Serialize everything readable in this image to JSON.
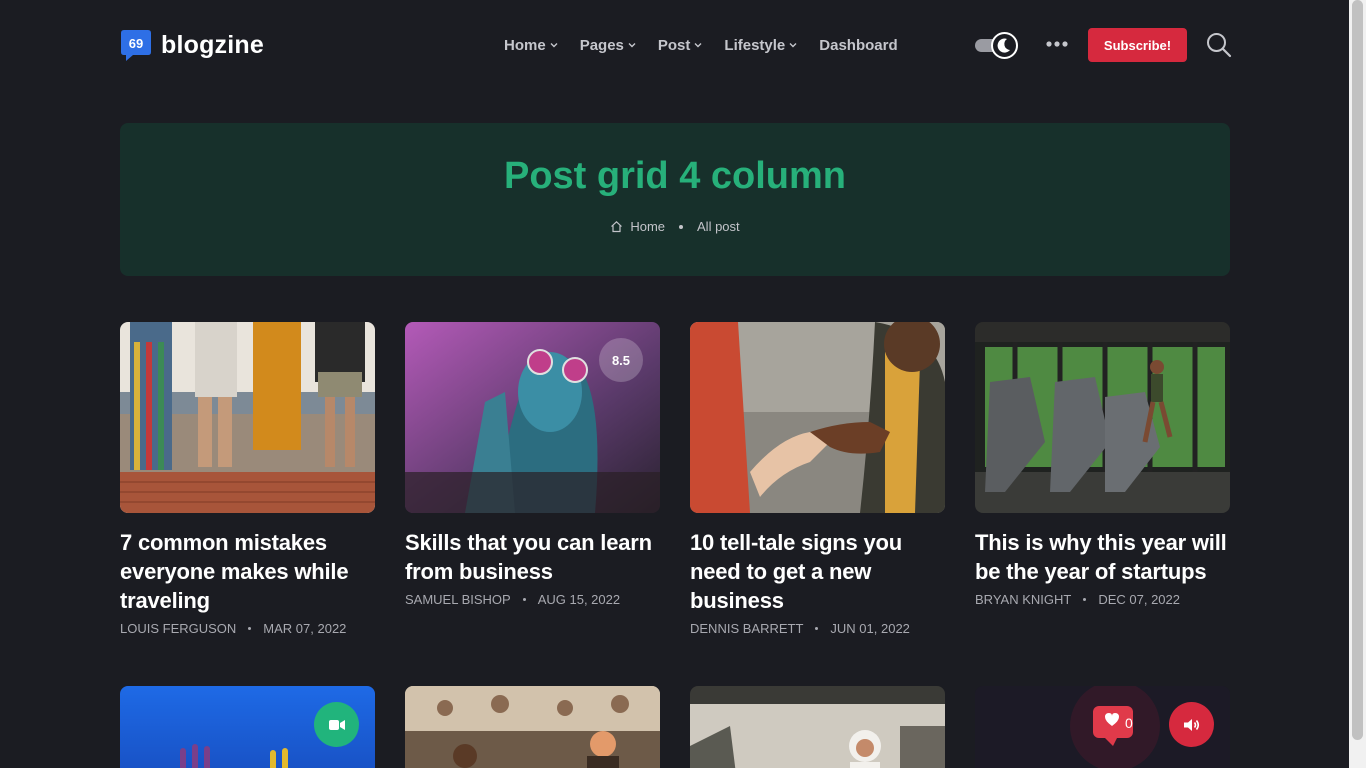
{
  "brand": {
    "name": "blogzine",
    "logo_glyph": "69"
  },
  "nav": {
    "items": [
      {
        "label": "Home",
        "has_dropdown": true
      },
      {
        "label": "Pages",
        "has_dropdown": true
      },
      {
        "label": "Post",
        "has_dropdown": true
      },
      {
        "label": "Lifestyle",
        "has_dropdown": true
      },
      {
        "label": "Dashboard",
        "has_dropdown": false
      }
    ],
    "theme_toggle": "dark",
    "more_icon": "ellipsis-icon",
    "subscribe_label": "Subscribe!",
    "search_icon": "search-icon"
  },
  "hero": {
    "title": "Post grid 4 column",
    "breadcrumb": [
      {
        "label": "Home",
        "icon": "home-icon"
      },
      {
        "label": "All post"
      }
    ]
  },
  "posts": [
    {
      "title": "7 common mistakes everyone makes while traveling",
      "author": "LOUIS FERGUSON",
      "date": "MAR 07, 2022"
    },
    {
      "title": "Skills that you can learn from business",
      "author": "SAMUEL BISHOP",
      "date": "AUG 15, 2022",
      "rating": "8.5"
    },
    {
      "title": "10 tell-tale signs you need to get a new business",
      "author": "DENNIS BARRETT",
      "date": "JUN 01, 2022"
    },
    {
      "title": "This is why this year will be the year of startups",
      "author": "BRYAN KNIGHT",
      "date": "DEC 07, 2022"
    }
  ],
  "row2_badges": [
    {
      "icon": "video-icon",
      "color": "#21b47c"
    },
    {
      "icon": "volume-icon",
      "color": "#d6293e"
    }
  ],
  "colors": {
    "background": "#1b1c22",
    "accent_green": "#27b07a",
    "hero_bg": "#17302b",
    "subscribe_red": "#d6293e"
  }
}
